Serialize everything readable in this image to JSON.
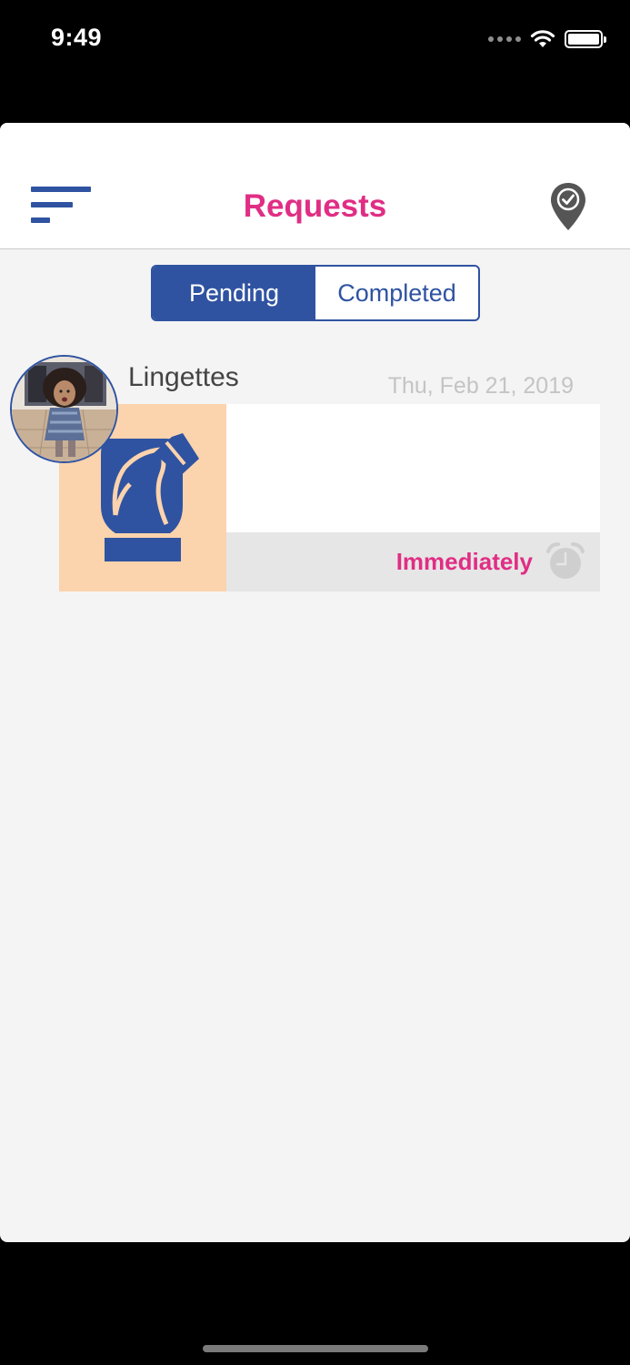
{
  "status_bar": {
    "time": "9:49"
  },
  "nav": {
    "title": "Requests",
    "menu_icon": "menu-lines-icon",
    "location_icon": "location-check-icon"
  },
  "tabs": {
    "items": [
      {
        "label": "Pending",
        "selected": true
      },
      {
        "label": "Completed",
        "selected": false
      }
    ]
  },
  "requests": [
    {
      "title": "Lingettes",
      "date": "Thu, Feb 21, 2019",
      "urgency": "Immediately",
      "item_icon": "wipes-package-icon",
      "timer_icon": "alarm-clock-icon"
    }
  ],
  "colors": {
    "brand_blue": "#2f53a1",
    "brand_pink": "#e02e84",
    "thumb_bg": "#fbd3ad"
  }
}
